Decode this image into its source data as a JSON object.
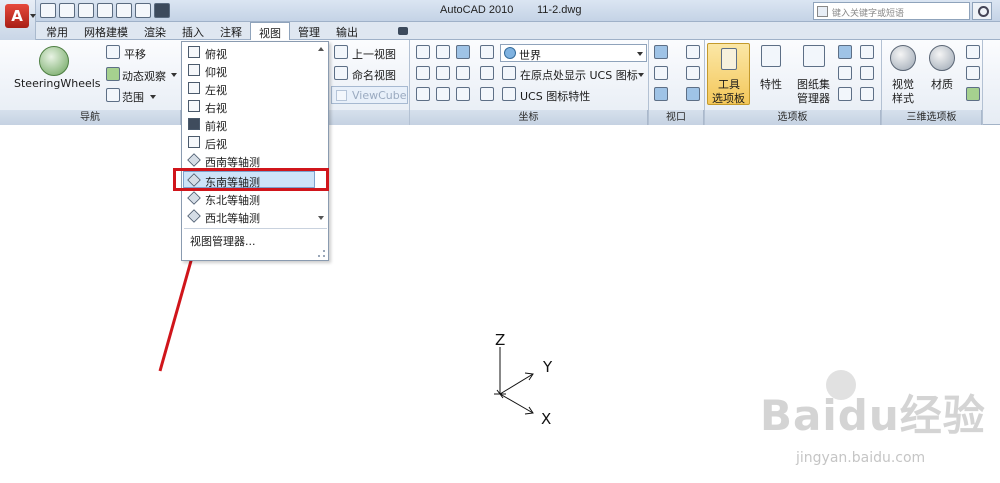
{
  "titlebar": {
    "app_title": "AutoCAD 2010",
    "file_name": "11-2.dwg",
    "search_placeholder": "键入关键字或短语"
  },
  "ribbon_tabs": [
    {
      "label": "常用",
      "active": false
    },
    {
      "label": "网格建模",
      "active": false
    },
    {
      "label": "渲染",
      "active": false
    },
    {
      "label": "插入",
      "active": false
    },
    {
      "label": "注释",
      "active": false
    },
    {
      "label": "视图",
      "active": true
    },
    {
      "label": "管理",
      "active": false
    },
    {
      "label": "输出",
      "active": false
    }
  ],
  "navigation_panel": {
    "title": "导航",
    "steeringwheels_label": "SteeringWheels",
    "pan_label": "平移",
    "orbit_label": "动态观察",
    "extents_label": "范围"
  },
  "views_panel": {
    "prev_view_label": "上一视图",
    "named_views_label": "命名视图",
    "viewcube_label": "ViewCube"
  },
  "coordinates_panel": {
    "title": "坐标",
    "ucs_world": "世界",
    "show_ucs_origin": "在原点处显示 UCS 图标",
    "ucs_properties": "UCS 图标特性"
  },
  "viewports_panel": {
    "title": "视口"
  },
  "palettes_panel": {
    "title": "选项板",
    "tool_palettes_label_1": "工具",
    "tool_palettes_label_2": "选项板",
    "properties_label": "特性",
    "sheetset_label_1": "图纸集",
    "sheetset_label_2": "管理器"
  },
  "palettes_3d_panel": {
    "title": "三维选项板",
    "visual_styles_label_1": "视觉",
    "visual_styles_label_2": "样式",
    "materials_label": "材质"
  },
  "view_menu": {
    "items": [
      {
        "label": "俯视",
        "highlighted": false
      },
      {
        "label": "仰视",
        "highlighted": false
      },
      {
        "label": "左视",
        "highlighted": false
      },
      {
        "label": "右视",
        "highlighted": false
      },
      {
        "label": "前视",
        "highlighted": false
      },
      {
        "label": "后视",
        "highlighted": false
      },
      {
        "label": "西南等轴测",
        "highlighted": false
      },
      {
        "label": "东南等轴测",
        "highlighted": true
      },
      {
        "label": "东北等轴测",
        "highlighted": false
      },
      {
        "label": "西北等轴测",
        "highlighted": false
      }
    ],
    "manager_label": "视图管理器..."
  },
  "ucs_axes": {
    "z": "Z",
    "y": "Y",
    "x": "X"
  },
  "watermark": {
    "brand": "Baidu经验",
    "url": "jingyan.baidu.com"
  },
  "colors": {
    "annotation_red": "#d0151b",
    "highlight": "#cde3f8"
  }
}
